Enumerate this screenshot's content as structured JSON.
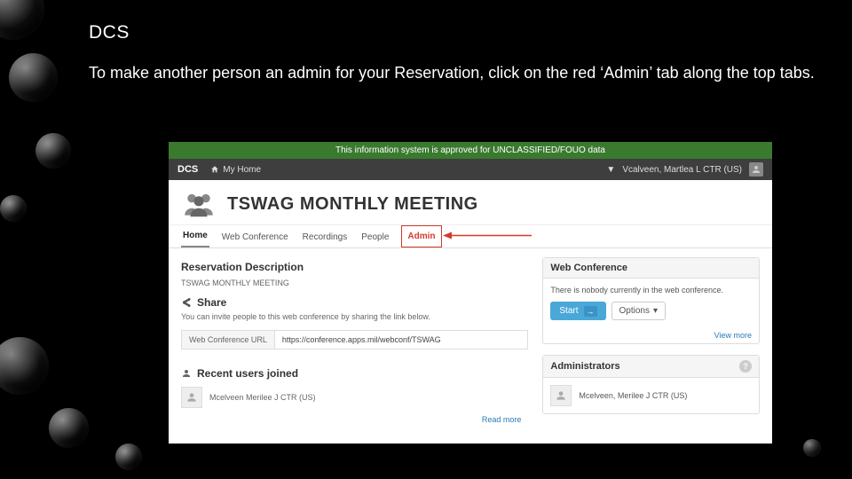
{
  "slide": {
    "title": "DCS",
    "body": "To make another person an admin for your Reservation, click on the red ‘Admin’ tab along the top tabs."
  },
  "screenshot": {
    "banner": "This information system is approved for UNCLASSIFIED/FOUO data",
    "nav": {
      "brand": "DCS",
      "home": "My Home",
      "caret": "▼",
      "user": "Vcalveen, Martlea L CTR (US)"
    },
    "header_title": "TSWAG MONTHLY MEETING",
    "tabs": {
      "home": "Home",
      "web_conference": "Web Conference",
      "recordings": "Recordings",
      "people": "People",
      "admin": "Admin"
    },
    "left": {
      "resv_desc_h": "Reservation Description",
      "resv_desc_v": "TSWAG MONTHLY MEETING",
      "share_h": "Share",
      "share_sub": "You can invite people to this web conference by sharing the link below.",
      "url_label": "Web Conference URL",
      "url_value": "https://conference.apps.mil/webconf/TSWAG",
      "recent_h": "Recent users joined",
      "recent_user": "Mcelveen Merilee J CTR (US)",
      "read_more": "Read more"
    },
    "right": {
      "webconf_h": "Web Conference",
      "webconf_body": "There is nobody currently in the web conference.",
      "start": "Start",
      "options": "Options",
      "caret": "▾",
      "view_more": "View more",
      "admins_h": "Administrators",
      "admin_user": "Mcelveen, Merilee J CTR (US)",
      "help": "?"
    }
  }
}
